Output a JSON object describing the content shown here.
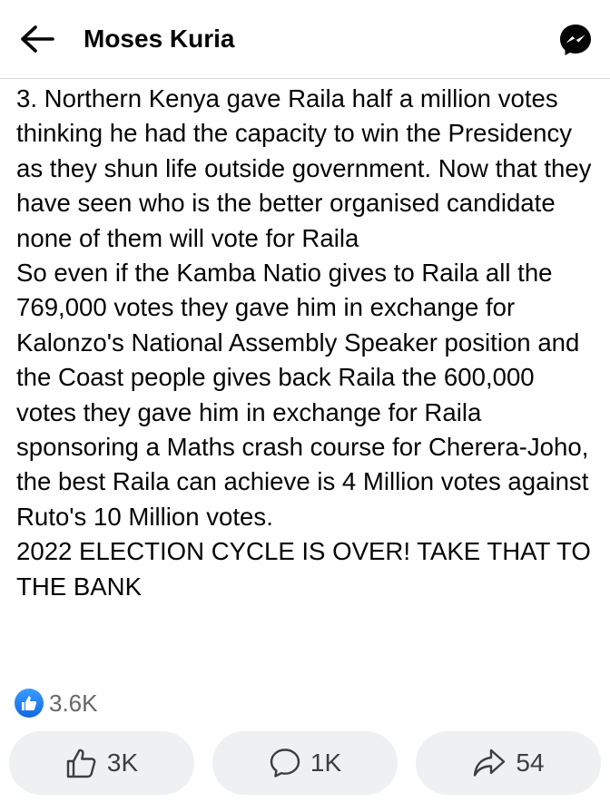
{
  "header": {
    "title": "Moses Kuria",
    "back_icon": "arrow-left-icon",
    "messenger_icon": "messenger-icon"
  },
  "post": {
    "paragraphs": [
      "3. Northern Kenya gave Raila half a million votes thinking he had the capacity to win the Presidency as they shun life outside government. Now that they have seen who is the better organised candidate none of them will vote for Raila",
      "So even if the Kamba Natio gives to Raila all the 769,000 votes they gave him in exchange for Kalonzo's National Assembly Speaker position and the Coast people gives back Raila the 600,000 votes they gave him in exchange for Raila sponsoring a Maths crash course for Cherera-Joho, the best Raila can achieve is 4 Million votes against Ruto's 10 Million votes.",
      "2022 ELECTION CYCLE IS OVER! TAKE THAT TO THE BANK"
    ]
  },
  "reactions": {
    "total": "3.6K",
    "icon": "like-badge-icon",
    "color": "#1877f2"
  },
  "actions": {
    "like": {
      "count": "3K",
      "icon": "thumbs-up-icon"
    },
    "comment": {
      "count": "1K",
      "icon": "comment-icon"
    },
    "share": {
      "count": "54",
      "icon": "share-icon"
    }
  }
}
